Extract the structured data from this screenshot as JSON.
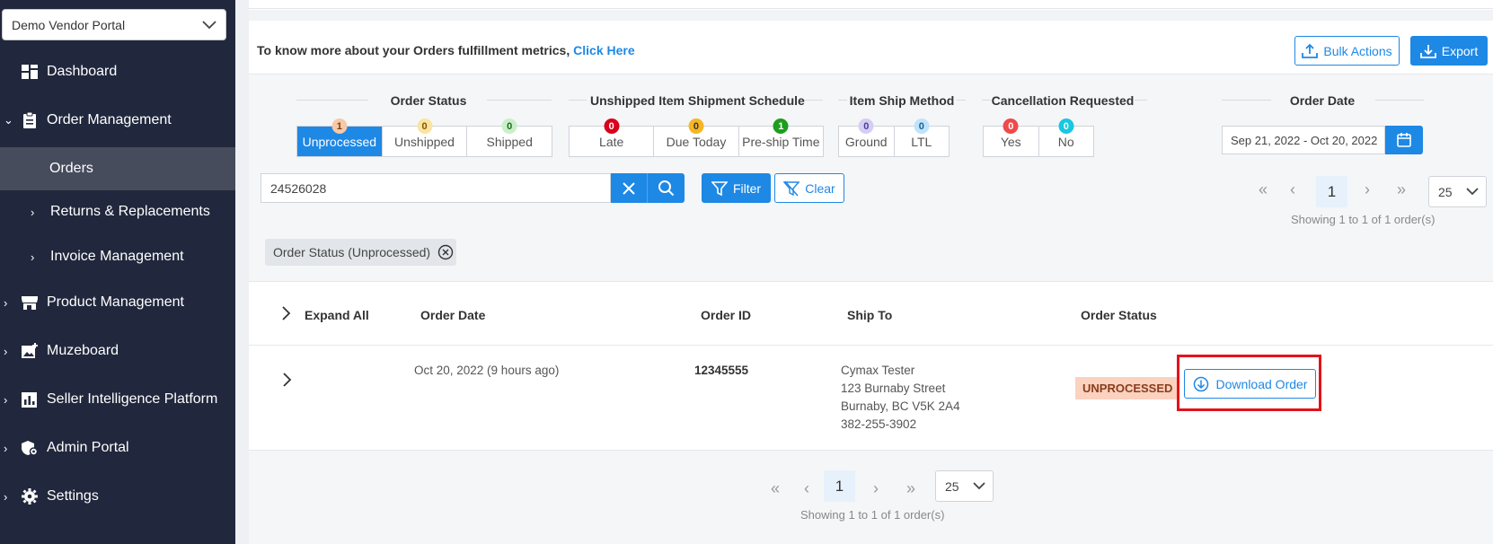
{
  "sidebar": {
    "vendor_select": "Demo Vendor Portal",
    "items": [
      {
        "label": "Dashboard",
        "icon": "dashboard-icon"
      },
      {
        "label": "Order Management",
        "icon": "clipboard-icon"
      },
      {
        "label": "Orders"
      },
      {
        "label": "Returns & Replacements"
      },
      {
        "label": "Invoice Management"
      },
      {
        "label": "Product Management",
        "icon": "store-icon"
      },
      {
        "label": "Muzeboard",
        "icon": "image-plus-icon"
      },
      {
        "label": "Seller Intelligence Platform",
        "icon": "bar-chart-icon"
      },
      {
        "label": "Admin Portal",
        "icon": "shield-gear-icon"
      },
      {
        "label": "Settings",
        "icon": "gear-icon"
      }
    ]
  },
  "banner": {
    "text": "To know more about your Orders fulfillment metrics,",
    "link": "Click Here",
    "bulk_actions": "Bulk Actions",
    "export": "Export"
  },
  "filters": {
    "order_status": {
      "title": "Order Status",
      "options": [
        {
          "label": "Unprocessed",
          "count": "1",
          "badge_color": "#f6c9a8",
          "selected": true
        },
        {
          "label": "Unshipped",
          "count": "0",
          "badge_color": "#fce3a0"
        },
        {
          "label": "Shipped",
          "count": "0",
          "badge_color": "#c9efc9"
        }
      ]
    },
    "shipment_schedule": {
      "title": "Unshipped Item Shipment Schedule",
      "options": [
        {
          "label": "Late",
          "count": "0",
          "badge_color": "#d9001b"
        },
        {
          "label": "Due Today",
          "count": "0",
          "badge_color": "#f6b623"
        },
        {
          "label": "Pre-ship Time",
          "count": "1",
          "badge_color": "#1d9e1d"
        }
      ]
    },
    "ship_method": {
      "title": "Item Ship Method",
      "options": [
        {
          "label": "Ground",
          "count": "0",
          "badge_color": "#d6cdf5"
        },
        {
          "label": "LTL",
          "count": "0",
          "badge_color": "#bfe3fb"
        }
      ]
    },
    "cancellation": {
      "title": "Cancellation Requested",
      "options": [
        {
          "label": "Yes",
          "count": "0",
          "badge_color": "#ee4a4a"
        },
        {
          "label": "No",
          "count": "0",
          "badge_color": "#18c7e0"
        }
      ]
    },
    "order_date": {
      "title": "Order Date",
      "value": "Sep 21, 2022 - Oct 20, 2022"
    }
  },
  "search": {
    "value": "24526028",
    "filter_label": "Filter",
    "clear_label": "Clear"
  },
  "pagination": {
    "page": "1",
    "page_size": "25",
    "summary": "Showing 1 to 1 of 1 order(s)"
  },
  "active_chip": "Order Status (Unprocessed)",
  "table": {
    "headers": {
      "expand": "Expand All",
      "order_date": "Order Date",
      "order_id": "Order ID",
      "ship_to": "Ship To",
      "order_status": "Order Status"
    },
    "rows": [
      {
        "order_date": "Oct 20, 2022 (9 hours ago)",
        "order_id": "12345555",
        "ship_to": [
          "Cymax Tester",
          "123 Burnaby Street",
          "Burnaby, BC V5K 2A4",
          "382-255-3902"
        ],
        "status": "UNPROCESSED",
        "download_label": "Download Order"
      }
    ]
  },
  "colors": {
    "sidebar_bg": "#21283d",
    "accent": "#1e88e5",
    "highlight": "#e3131b"
  }
}
